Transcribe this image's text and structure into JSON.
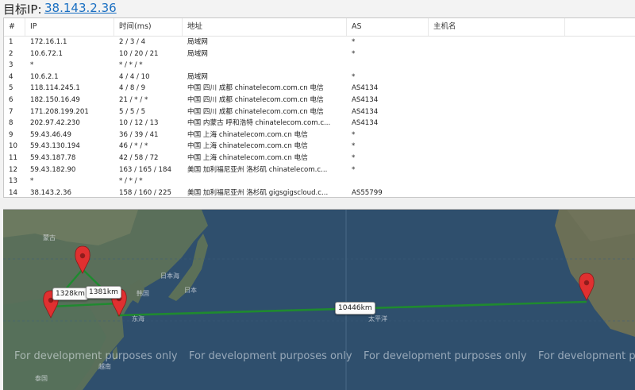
{
  "header": {
    "label": "目标IP:",
    "ip": "38.143.2.36"
  },
  "columns": [
    "#",
    "IP",
    "时间(ms)",
    "地址",
    "AS",
    "主机名"
  ],
  "rows": [
    {
      "n": "1",
      "ip": "172.16.1.1",
      "time": "2 / 3 / 4",
      "addr": "局域网",
      "as": "*"
    },
    {
      "n": "2",
      "ip": "10.6.72.1",
      "time": "10 / 20 / 21",
      "addr": "局域网",
      "as": "*"
    },
    {
      "n": "3",
      "ip": "*",
      "time": "* / * / *",
      "addr": "",
      "as": ""
    },
    {
      "n": "4",
      "ip": "10.6.2.1",
      "time": "4 / 4 / 10",
      "addr": "局域网",
      "as": "*"
    },
    {
      "n": "5",
      "ip": "118.114.245.1",
      "time": "4 / 8 / 9",
      "addr": "中国 四川 成都 chinatelecom.com.cn 电信",
      "as": "AS4134"
    },
    {
      "n": "6",
      "ip": "182.150.16.49",
      "time": "21 / * / *",
      "addr": "中国 四川 成都 chinatelecom.com.cn 电信",
      "as": "AS4134"
    },
    {
      "n": "7",
      "ip": "171.208.199.201",
      "time": "5 / 5 / 5",
      "addr": "中国 四川 成都 chinatelecom.com.cn 电信",
      "as": "AS4134"
    },
    {
      "n": "8",
      "ip": "202.97.42.230",
      "time": "10 / 12 / 13",
      "addr": "中国 内蒙古 呼和浩特 chinatelecom.com.c...",
      "as": "AS4134"
    },
    {
      "n": "9",
      "ip": "59.43.46.49",
      "time": "36 / 39 / 41",
      "addr": "中国 上海 chinatelecom.com.cn 电信",
      "as": "*"
    },
    {
      "n": "10",
      "ip": "59.43.130.194",
      "time": "46 / * / *",
      "addr": "中国 上海 chinatelecom.com.cn 电信",
      "as": "*"
    },
    {
      "n": "11",
      "ip": "59.43.187.78",
      "time": "42 / 58 / 72",
      "addr": "中国 上海 chinatelecom.com.cn 电信",
      "as": "*"
    },
    {
      "n": "12",
      "ip": "59.43.182.90",
      "time": "163 / 165 / 184",
      "addr": "美国 加利福尼亚州 洛杉矶 chinatelecom.c...",
      "as": "*"
    },
    {
      "n": "13",
      "ip": "*",
      "time": "* / * / *",
      "addr": "",
      "as": ""
    },
    {
      "n": "14",
      "ip": "38.143.2.36",
      "time": "158 / 160 / 225",
      "addr": "美国 加利福尼亚州 洛杉矶 gigsgigscloud.c...",
      "as": "AS55799"
    }
  ],
  "map": {
    "distances": [
      "1328km",
      "1381km",
      "10446km"
    ],
    "watermark": "For development purposes only",
    "labels": [
      "蒙古",
      "日本海",
      "日本",
      "韩国",
      "东海",
      "太平洋",
      "泰国",
      "越南"
    ],
    "route_color": "#1f8a2f",
    "marker_color": "#e03030",
    "icons": [
      "map-marker-icon"
    ]
  }
}
